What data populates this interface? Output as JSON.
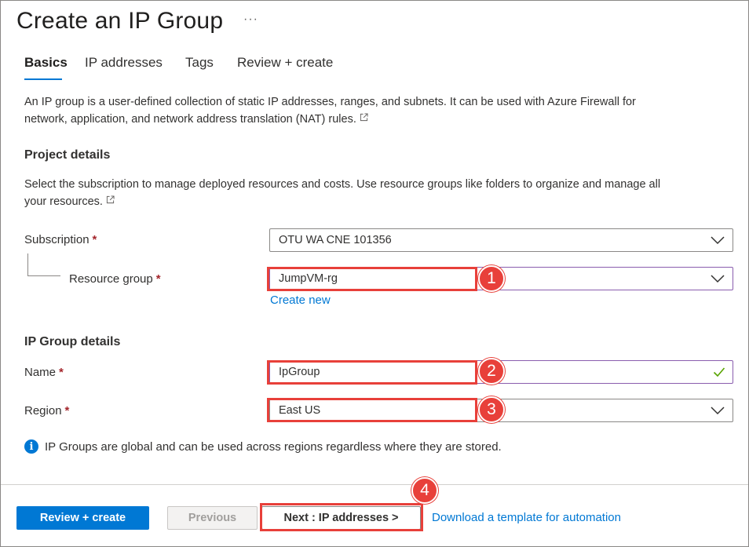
{
  "page": {
    "title": "Create an IP Group",
    "more_label": "···"
  },
  "tabs": [
    {
      "label": "Basics",
      "active": true
    },
    {
      "label": "IP addresses",
      "active": false
    },
    {
      "label": "Tags",
      "active": false
    },
    {
      "label": "Review + create",
      "active": false
    }
  ],
  "intro": {
    "line1": "An IP group is a user-defined collection of static IP addresses, ranges, and subnets. It can be used with Azure Firewall for",
    "line2": "network, application, and network address translation (NAT) rules.",
    "icon": "external-link-icon"
  },
  "project_details": {
    "title": "Project details",
    "desc_line1": "Select the subscription to manage deployed resources and costs. Use resource groups like folders to organize and manage all",
    "desc_line2": "your resources.",
    "subscription": {
      "label": "Subscription",
      "required_mark": "*",
      "value": "OTU WA CNE 101356"
    },
    "resource_group": {
      "label": "Resource group",
      "required_mark": "*",
      "value": "JumpVM-rg",
      "create_new": "Create new"
    }
  },
  "ip_group_details": {
    "title": "IP Group details",
    "name": {
      "label": "Name",
      "required_mark": "*",
      "value": "IpGroup",
      "valid_icon": "checkmark-icon"
    },
    "region": {
      "label": "Region",
      "required_mark": "*",
      "value": "East US"
    }
  },
  "info": {
    "icon": "info-icon",
    "icon_glyph": "i",
    "text": "IP Groups are global and can be used across regions regardless where they are stored."
  },
  "footer": {
    "review_create": "Review + create",
    "previous": "Previous",
    "next": "Next : IP addresses >",
    "download_template": "Download a template for automation"
  },
  "annotations": [
    {
      "number": "1",
      "target": "Resource group"
    },
    {
      "number": "2",
      "target": "Name"
    },
    {
      "number": "3",
      "target": "Region"
    },
    {
      "number": "4",
      "target": "Next : IP addresses >"
    }
  ],
  "colors": {
    "accent": "#0078d4",
    "required": "#a4262c",
    "callout": "#e8403a",
    "valid": "#57a300",
    "focus_border": "#8a5dae"
  }
}
